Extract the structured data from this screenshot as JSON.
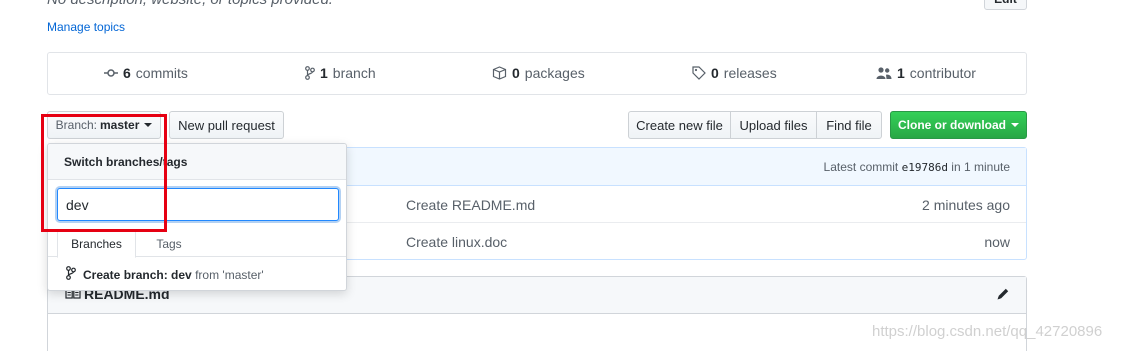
{
  "repo": {
    "description": "No description, website, or topics provided.",
    "edit_label": "Edit",
    "manage_topics": "Manage topics"
  },
  "summary": {
    "commits": {
      "count": "6",
      "label": "commits"
    },
    "branches": {
      "count": "1",
      "label": "branch"
    },
    "packages": {
      "count": "0",
      "label": "packages"
    },
    "releases": {
      "count": "0",
      "label": "releases"
    },
    "contributors": {
      "count": "1",
      "label": "contributor"
    }
  },
  "toolbar": {
    "branch_prefix": "Branch:",
    "branch_name": "master",
    "new_pull_request": "New pull request",
    "create_new_file": "Create new file",
    "upload_files": "Upload files",
    "find_file": "Find file",
    "clone_or_download": "Clone or download"
  },
  "commits": {
    "latest_label": "Latest commit",
    "latest_sha": "e19786d",
    "latest_time": "in 1 minute"
  },
  "files": [
    {
      "message": "Create README.md",
      "age": "2 minutes ago"
    },
    {
      "message": "Create linux.doc",
      "age": "now"
    }
  ],
  "readme": {
    "title": "README.md"
  },
  "branch_dropdown": {
    "title": "Switch branches/tags",
    "filter_value": "dev",
    "tabs": [
      "Branches",
      "Tags"
    ],
    "create_prefix": "Create branch:",
    "create_name": "dev",
    "create_from": "from 'master'"
  },
  "watermark": "https://blog.csdn.net/qq_42720896",
  "colors": {
    "accent_blue": "#0366d6",
    "clone_green": "#28a745",
    "highlight_red": "#e60012",
    "commit_header_bg": "#f1f8ff"
  },
  "icons": [
    "commit-icon",
    "branch-icon",
    "package-icon",
    "tag-icon",
    "people-icon",
    "book-icon",
    "pencil-icon",
    "git-branch-icon"
  ]
}
